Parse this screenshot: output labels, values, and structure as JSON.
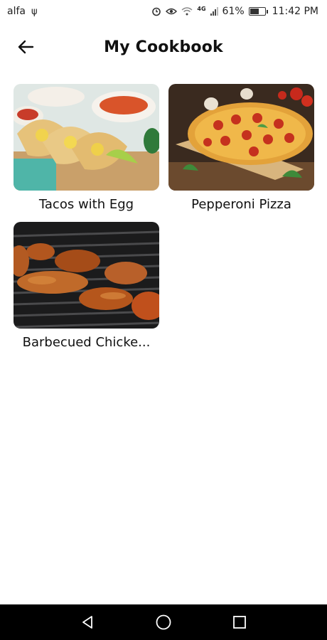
{
  "status_bar": {
    "carrier": "alfa",
    "network": "4G",
    "battery_percent": "61%",
    "time": "11:42 PM",
    "icons": [
      "usb-icon",
      "alarm-icon",
      "eye-icon",
      "wifi-icon",
      "signal-icon",
      "battery-icon"
    ]
  },
  "app_bar": {
    "title": "My Cookbook",
    "back_icon": "arrow-left-icon"
  },
  "recipes": [
    {
      "title": "Tacos with Egg",
      "image": "tacos-photo"
    },
    {
      "title": "Pepperoni Pizza",
      "image": "pizza-photo"
    },
    {
      "title": "Barbecued Chicke...",
      "image": "bbq-chicken-photo"
    }
  ],
  "nav_bar": {
    "buttons": [
      "back-triangle-icon",
      "home-circle-icon",
      "recents-square-icon"
    ],
    "background": "#000000"
  }
}
